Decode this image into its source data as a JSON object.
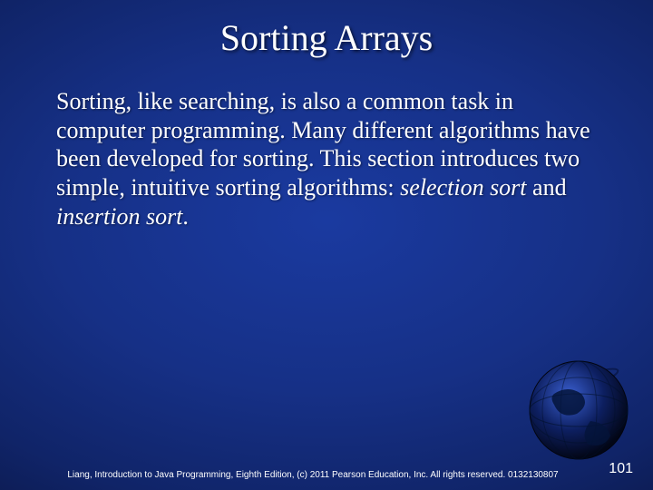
{
  "title": "Sorting Arrays",
  "body": {
    "p1": "Sorting, like searching, is also a common task in computer programming. Many different algorithms have been developed for sorting. This section introduces two simple, intuitive sorting algorithms: ",
    "em1": "selection sort",
    "mid": " and ",
    "em2": "insertion sort",
    "tail": "."
  },
  "footer": "Liang, Introduction to Java Programming, Eighth Edition, (c) 2011 Pearson Education, Inc. All rights reserved. 0132130807",
  "page_number": "101"
}
